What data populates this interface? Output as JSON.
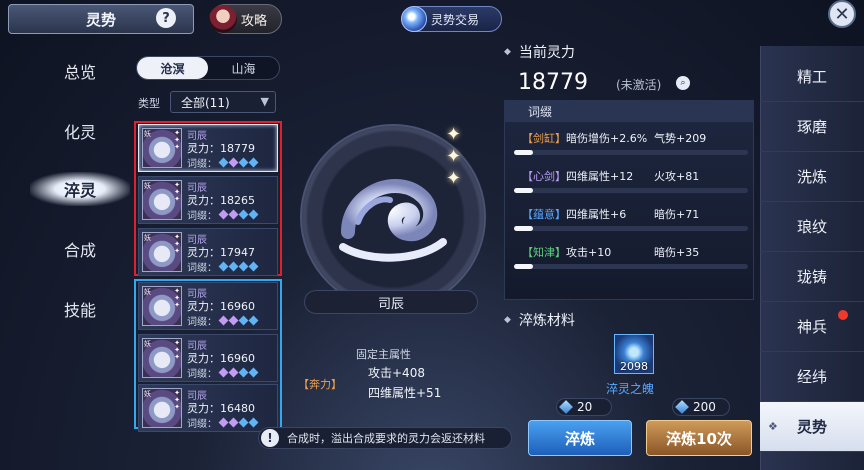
{
  "header": {
    "title": "灵势",
    "help_icon": "?",
    "guide_label": "攻略",
    "trade_label": "灵势交易",
    "close_icon": "✕"
  },
  "left_nav": [
    {
      "label": "总览",
      "active": false
    },
    {
      "label": "化灵",
      "active": false
    },
    {
      "label": "淬灵",
      "active": true
    },
    {
      "label": "合成",
      "active": false
    },
    {
      "label": "技能",
      "active": false
    }
  ],
  "filter": {
    "segments": [
      {
        "label": "沧溟",
        "active": true
      },
      {
        "label": "山海",
        "active": false
      }
    ],
    "type_label": "类型",
    "type_value": "全部(11)"
  },
  "cards": [
    {
      "tag": "妖",
      "name": "司辰",
      "power": "灵力：18779",
      "affix_label": "词缀：",
      "affix_colors": [
        "b",
        "p",
        "b",
        "b"
      ],
      "selected": true
    },
    {
      "tag": "妖",
      "name": "司辰",
      "power": "灵力：18265",
      "affix_label": "词缀：",
      "affix_colors": [
        "p",
        "p",
        "b",
        "b"
      ],
      "selected": false
    },
    {
      "tag": "妖",
      "name": "司辰",
      "power": "灵力：17947",
      "affix_label": "词缀：",
      "affix_colors": [
        "b",
        "b",
        "b",
        "b"
      ],
      "selected": false
    },
    {
      "tag": "妖",
      "name": "司辰",
      "power": "灵力：16960",
      "affix_label": "词缀：",
      "affix_colors": [
        "p",
        "p",
        "b",
        "b"
      ],
      "selected": false
    },
    {
      "tag": "妖",
      "name": "司辰",
      "power": "灵力：16960",
      "affix_label": "词缀：",
      "affix_colors": [
        "p",
        "p",
        "b",
        "b"
      ],
      "selected": false
    },
    {
      "tag": "妖",
      "name": "司辰",
      "power": "灵力：16480",
      "affix_label": "词缀：",
      "affix_colors": [
        "p",
        "p",
        "b",
        "b"
      ],
      "selected": false
    }
  ],
  "center": {
    "name": "司辰",
    "fixed_title": "固定主属性",
    "fixed_tag": "【奔力】",
    "fixed_attrs": [
      "攻击+408",
      "四维属性+51"
    ],
    "tip": "合成时，溢出合成要求的灵力会返还材料",
    "tip_icon": "!"
  },
  "detail": {
    "current_title": "当前灵力",
    "power": "18779",
    "inactive_label": "(未激活)",
    "affix_header": "词缀",
    "affixes": [
      {
        "tag": "【剑缸】",
        "tag_color": "#f0a04a",
        "left": "暗伤增伤+2.6%",
        "right": "气势+209",
        "fill": 0.08
      },
      {
        "tag": "【心剑】",
        "tag_color": "#b99cf4",
        "left": "四维属性+12",
        "right": "火攻+81",
        "fill": 0.08
      },
      {
        "tag": "【蕴意】",
        "tag_color": "#5aa8ff",
        "left": "四维属性+6",
        "right": "暗伤+71",
        "fill": 0.08
      },
      {
        "tag": "【知津】",
        "tag_color": "#5ad07a",
        "left": "攻击+10",
        "right": "暗伤+35",
        "fill": 0.08
      }
    ],
    "material_title": "淬炼材料",
    "material_count": "2098",
    "material_name": "淬灵之魄",
    "cost_single": "20",
    "cost_ten": "200",
    "btn_refine": "淬炼",
    "btn_refine10": "淬炼10次"
  },
  "right_tabs": [
    {
      "label": "精工",
      "active": false
    },
    {
      "label": "琢磨",
      "active": false
    },
    {
      "label": "洗炼",
      "active": false
    },
    {
      "label": "琅纹",
      "active": false
    },
    {
      "label": "珑铸",
      "active": false
    },
    {
      "label": "神兵",
      "active": false
    },
    {
      "label": "经纬",
      "active": false
    },
    {
      "label": "灵势",
      "active": true
    }
  ],
  "colors": {
    "accent_blue": "#33a7f0",
    "accent_red": "#e0202a",
    "tip_highlight": "#f0a04a"
  }
}
